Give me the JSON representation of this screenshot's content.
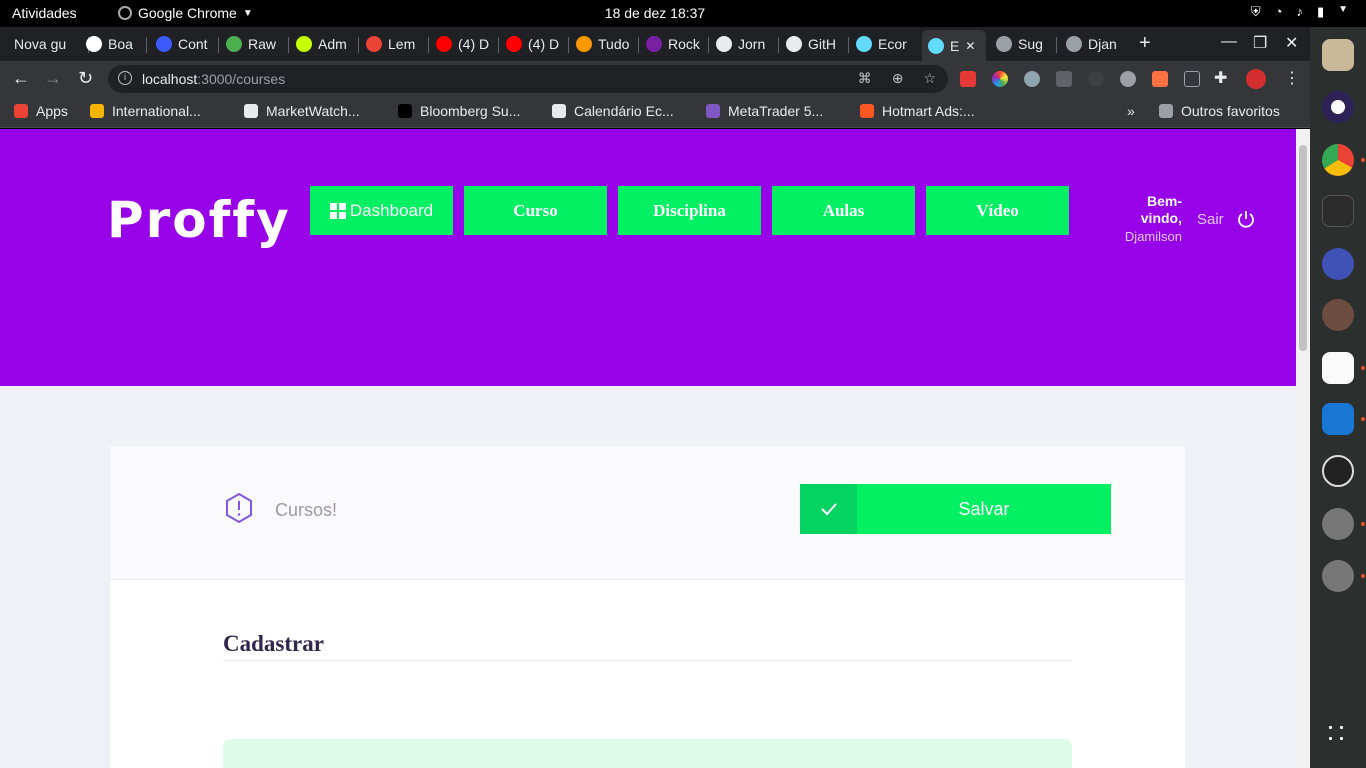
{
  "system": {
    "activities": "Atividades",
    "app_name": "Google Chrome",
    "clock": "18 de dez  18:37"
  },
  "tabs": [
    {
      "label": "Nova gu",
      "color": "#202124"
    },
    {
      "label": "Boa",
      "color": "#ffffff"
    },
    {
      "label": "Cont",
      "color": "#3d5afe"
    },
    {
      "label": "Raw",
      "color": "#4caf50"
    },
    {
      "label": "Adm",
      "color": "#c6ff00"
    },
    {
      "label": "Lem",
      "color": "#ea4335"
    },
    {
      "label": "(4) D",
      "color": "#ff0000"
    },
    {
      "label": "(4) D",
      "color": "#ff0000"
    },
    {
      "label": "Tudo",
      "color": "#ff9800"
    },
    {
      "label": "Rock",
      "color": "#7b1fa2"
    },
    {
      "label": "Jorn",
      "color": "#e8eaed"
    },
    {
      "label": "GitH",
      "color": "#e8eaed"
    },
    {
      "label": "Ecor",
      "color": "#61dafb"
    },
    {
      "label": "E",
      "color": "#61dafb"
    },
    {
      "label": "Sug",
      "color": "#9aa0a6"
    },
    {
      "label": "Djan",
      "color": "#9aa0a6"
    }
  ],
  "address_bar": {
    "host": "localhost",
    "path": ":3000/courses"
  },
  "bookmarks": [
    {
      "label": "Apps",
      "color": "#ea4335"
    },
    {
      "label": "International...",
      "color": "#f4b400"
    },
    {
      "label": "MarketWatch...",
      "color": "#e8eaed"
    },
    {
      "label": "Bloomberg Su...",
      "color": "#000000"
    },
    {
      "label": "Calendário Ec...",
      "color": "#e8eaed"
    },
    {
      "label": "MetaTrader 5...",
      "color": "#7e57c2"
    },
    {
      "label": "Hotmart Ads:...",
      "color": "#ff5722"
    }
  ],
  "bookmarks_more": "»",
  "other_bookmarks": "Outros favoritos",
  "app": {
    "logo": "Proffy",
    "nav": {
      "dashboard": "Dashboard",
      "curso": "Curso",
      "disciplina": "Disciplina",
      "aulas": "Aulas",
      "video": "Vídeo"
    },
    "welcome": "Bem-vindo,",
    "user": "Djamilson",
    "logout": "Sair"
  },
  "card": {
    "title": "Cursos!",
    "save": "Salvar",
    "section": "Cadastrar"
  },
  "colors": {
    "brand_purple": "#9702e8",
    "brand_green": "#04f063"
  }
}
